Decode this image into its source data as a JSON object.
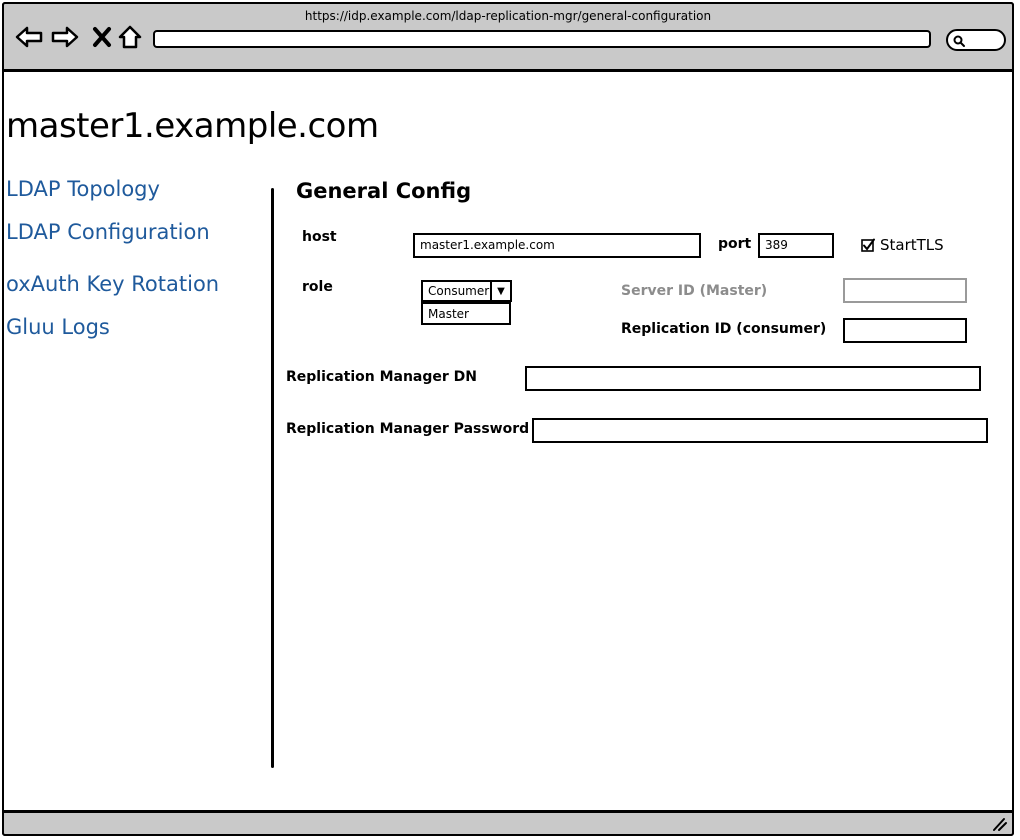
{
  "browser": {
    "url": "https://idp.example.com/ldap-replication-mgr/general-configuration",
    "nav_icons": [
      "back-arrow-icon",
      "forward-arrow-icon",
      "close-icon",
      "home-icon"
    ],
    "search_icon": "search-icon"
  },
  "page": {
    "title": "master1.example.com"
  },
  "sidebar": {
    "items": [
      {
        "label": "LDAP Topology"
      },
      {
        "label": "LDAP Configuration"
      },
      {
        "label": "oxAuth Key Rotation"
      },
      {
        "label": "Gluu Logs"
      }
    ],
    "link_color": "#1f5a9c"
  },
  "main": {
    "section_title": "General Config",
    "host": {
      "label": "host",
      "value": "master1.example.com"
    },
    "port": {
      "label": "port",
      "value": "389"
    },
    "starttls": {
      "label": "StartTLS",
      "checked": true
    },
    "role": {
      "label": "role",
      "selected": "Consumer",
      "options": [
        "Master"
      ]
    },
    "server_id": {
      "label": "Server ID (Master)",
      "value": "",
      "disabled": true
    },
    "replication_id": {
      "label": "Replication ID (consumer)",
      "value": ""
    },
    "manager_dn": {
      "label": "Replication Manager DN",
      "value": ""
    },
    "manager_password": {
      "label": "Replication Manager Password",
      "value": ""
    }
  }
}
